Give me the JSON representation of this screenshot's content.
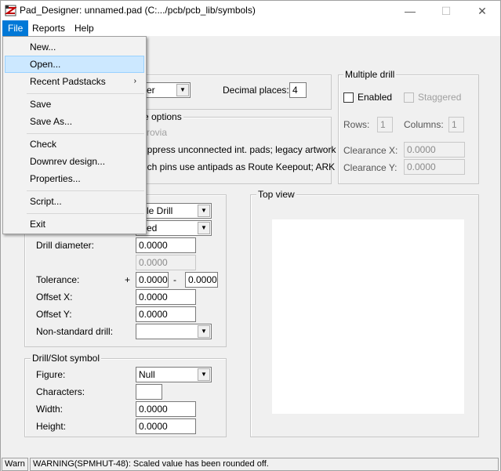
{
  "window": {
    "title": "Pad_Designer: unnamed.pad (C:.../pcb/pcb_lib/symbols)",
    "minimize_glyph": "—",
    "maximize_glyph": "☐",
    "close_glyph": "✕"
  },
  "menubar": {
    "file": "File",
    "reports": "Reports",
    "help": "Help"
  },
  "file_menu": {
    "new": "New...",
    "open": "Open...",
    "recent": "Recent Padstacks",
    "save": "Save",
    "save_as": "Save As...",
    "check": "Check",
    "downrev": "Downrev design...",
    "properties": "Properties...",
    "script": "Script...",
    "exit": "Exit",
    "submenu_arrow": "›"
  },
  "units": {
    "value_partial": "eter",
    "decimal_label": "Decimal places:",
    "decimal_value": "4"
  },
  "usage_options": {
    "label_partial": "e options",
    "microvia_partial": "crovia",
    "suppress_partial": "uppress unconnected int. pads; legacy artwork",
    "mech_partial": "ech pins use antipads as Route Keepout; ARK"
  },
  "multiple_drill": {
    "label": "Multiple drill",
    "enabled": "Enabled",
    "staggered": "Staggered",
    "rows_label": "Rows:",
    "rows_value": "1",
    "columns_label": "Columns:",
    "columns_value": "1",
    "clearance_x_label": "Clearance X:",
    "clearance_x_value": "0.0000",
    "clearance_y_label": "Clearance Y:",
    "clearance_y_value": "0.0000"
  },
  "drill": {
    "type_partial": "rcle Drill",
    "plating_partial": "ated",
    "diameter_label": "Drill diameter:",
    "diameter_value": "0.0000",
    "diameter_value2": "0.0000",
    "tolerance_label": "Tolerance:",
    "plus": "+",
    "minus": "-",
    "tol_plus_value": "0.0000",
    "tol_minus_value": "0.0000",
    "offset_x_label": "Offset X:",
    "offset_x_value": "0.0000",
    "offset_y_label": "Offset Y:",
    "offset_y_value": "0.0000",
    "nonstandard_label": "Non-standard drill:",
    "nonstandard_value": ""
  },
  "symbol": {
    "label": "Drill/Slot symbol",
    "figure_label": "Figure:",
    "figure_value": "Null",
    "characters_label": "Characters:",
    "characters_value": "",
    "width_label": "Width:",
    "width_value": "0.0000",
    "height_label": "Height:",
    "height_value": "0.0000"
  },
  "top_view": {
    "label": "Top view"
  },
  "status": {
    "level": "Warn",
    "message": "WARNING(SPMHUT-48): Scaled value has been rounded off."
  },
  "colors": {
    "menu_active": "#0078d7",
    "menu_hover": "#cce8ff"
  }
}
